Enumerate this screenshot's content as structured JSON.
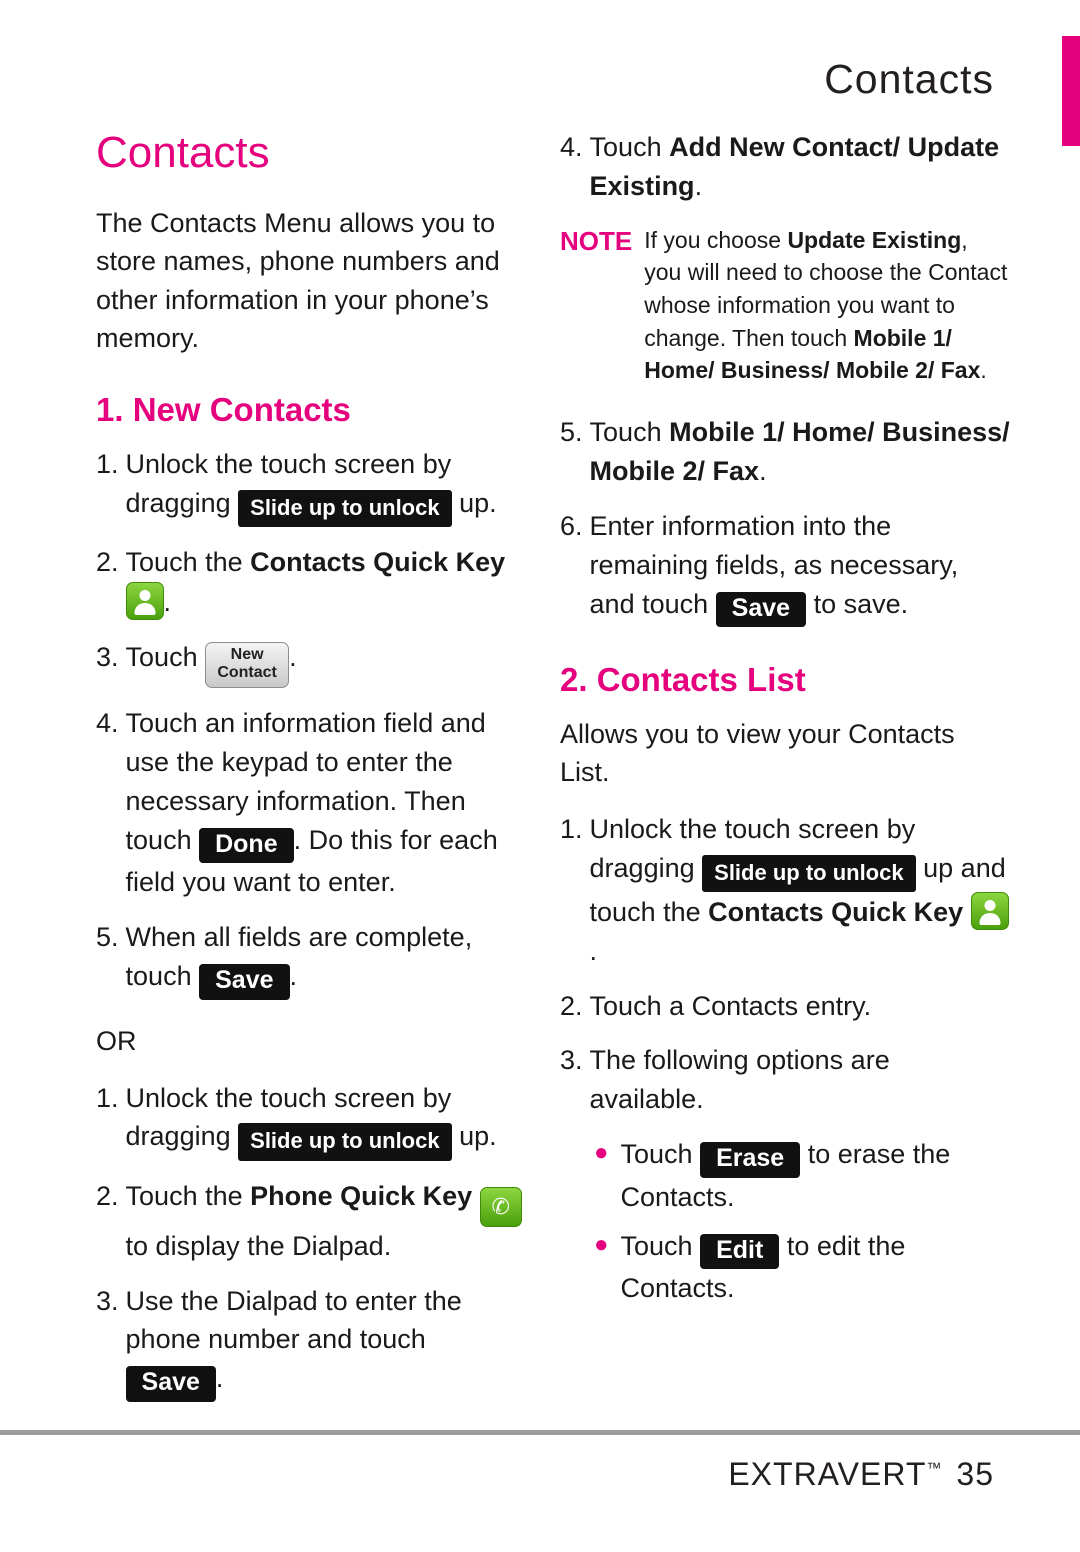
{
  "header": {
    "title": "Contacts",
    "accent_color": "#e5007d"
  },
  "left": {
    "chapter_title": "Contacts",
    "intro": "The Contacts Menu allows you to store names, phone numbers and other information in your phone’s memory.",
    "section1_title": "1. New Contacts",
    "s1_step1_num": "1.",
    "s1_step1_a": "Unlock the touch screen by dragging",
    "s1_step1_key": "Slide up to unlock",
    "s1_step1_b": "up.",
    "s1_step2_num": "2.",
    "s1_step2_a": "Touch the ",
    "s1_step2_bold": "Contacts Quick Key",
    "s1_step2_icon": "contacts-quick-key-icon",
    "s1_step2_b": ".",
    "s1_step3_num": "3.",
    "s1_step3_a": "Touch",
    "s1_step3_key_line1": "New",
    "s1_step3_key_line2": "Contact",
    "s1_step3_b": ".",
    "s1_step4_num": "4.",
    "s1_step4_a": "Touch an information field and use the keypad to enter the necessary information. Then touch",
    "s1_step4_key": "Done",
    "s1_step4_b": ". Do this for each field you want to enter.",
    "s1_step5_num": "5.",
    "s1_step5_a": "When all fields are complete, touch",
    "s1_step5_key": "Save",
    "s1_step5_b": ".",
    "or_label": "OR",
    "s2_step1_num": "1.",
    "s2_step1_a": "Unlock the touch screen by dragging",
    "s2_step1_key": "Slide up to unlock",
    "s2_step1_b": "up.",
    "s2_step2_num": "2.",
    "s2_step2_a": "Touch the ",
    "s2_step2_bold": "Phone Quick Key",
    "s2_step2_icon": "phone-quick-key-icon",
    "s2_step2_b": " to display the Dialpad.",
    "s2_step3_num": "3.",
    "s2_step3_a": "Use the Dialpad to enter the phone number and touch",
    "s2_step3_key": "Save",
    "s2_step3_b": "."
  },
  "right": {
    "r_step4_num": "4.",
    "r_step4_a": "Touch ",
    "r_step4_bold": "Add New Contact/ Update Existing",
    "r_step4_b": ".",
    "note_label": "NOTE",
    "note_a": "If you choose ",
    "note_bold1": "Update Existing",
    "note_b": ", you will need to choose the Contact whose information you want to change. Then touch ",
    "note_bold2": "Mobile 1/ Home/ Business/ Mobile 2/ Fax",
    "note_c": ".",
    "r_step5_num": "5.",
    "r_step5_a": "Touch ",
    "r_step5_bold": "Mobile 1/ Home/ Business/ Mobile 2/ Fax",
    "r_step5_b": ".",
    "r_step6_num": "6.",
    "r_step6_a": "Enter information into the remaining fields, as necessary, and touch",
    "r_step6_key": "Save",
    "r_step6_b": "to save.",
    "section2_title": "2. Contacts List",
    "section2_intro": "Allows you to view your Contacts List.",
    "c_step1_num": "1.",
    "c_step1_a": "Unlock the touch screen by dragging",
    "c_step1_key": "Slide up to unlock",
    "c_step1_b": "up",
    "c_step1_c": "and touch the ",
    "c_step1_bold": "Contacts Quick Key",
    "c_step1_icon": "contacts-quick-key-icon",
    "c_step1_d": ".",
    "c_step2_num": "2.",
    "c_step2_a": "Touch a Contacts entry.",
    "c_step3_num": "3.",
    "c_step3_a": "The following options are available.",
    "b1_a": "Touch",
    "b1_key": "Erase",
    "b1_b": "to erase the Contacts.",
    "b2_a": "Touch",
    "b2_key": "Edit",
    "b2_b": "to edit the Contacts."
  },
  "footer": {
    "brand": "EXTRAVERT",
    "tm": "™",
    "page_number": "35"
  }
}
